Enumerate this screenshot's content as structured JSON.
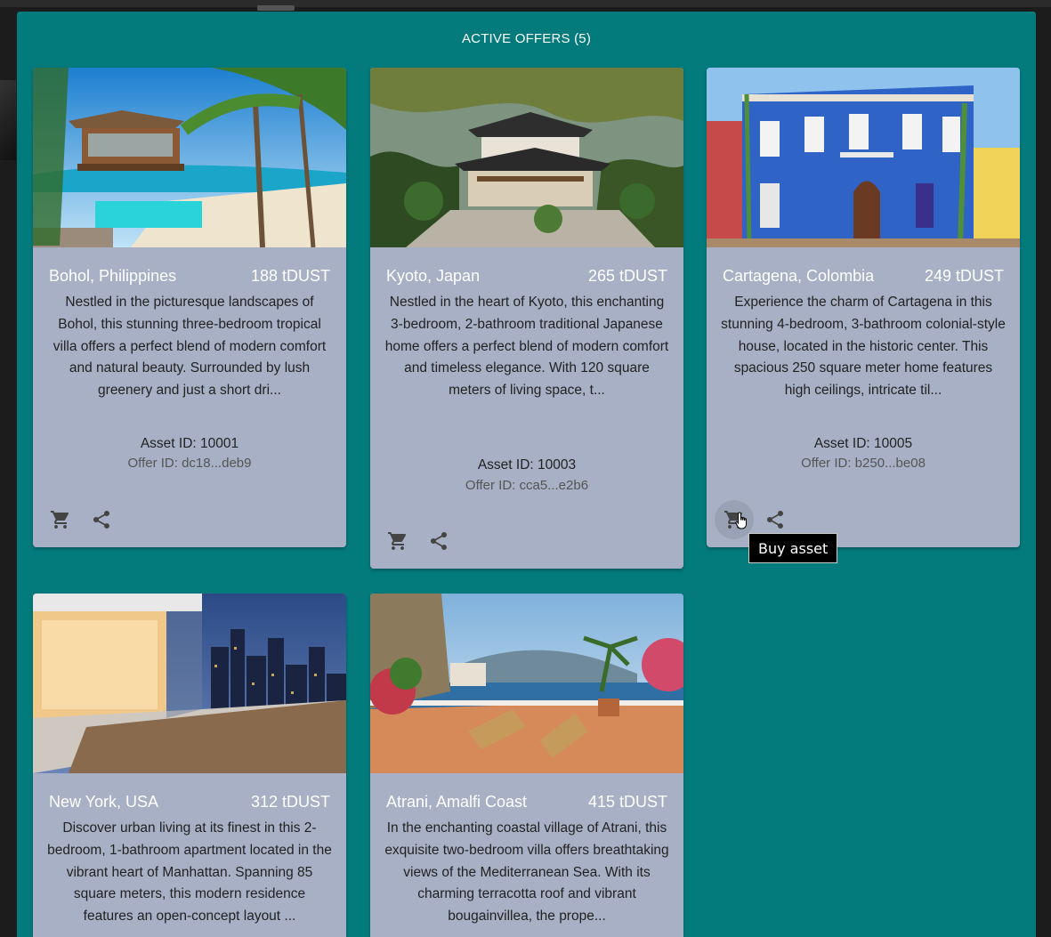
{
  "panel": {
    "title": "ACTIVE OFFERS (5)"
  },
  "offers": [
    {
      "location": "Bohol, Philippines",
      "price": "188 tDUST",
      "description": "Nestled in the picturesque landscapes of Bohol, this stunning three-bedroom tropical villa offers a perfect blend of modern comfort and natural beauty. Surrounded by lush greenery and just a short dri...",
      "asset_id": "Asset ID: 10001",
      "offer_id": "Offer ID: dc18...deb9",
      "image": "tropical-villa-pool-beach"
    },
    {
      "location": "Kyoto, Japan",
      "price": "265 tDUST",
      "description": "Nestled in the heart of Kyoto, this enchanting 3-bedroom, 2-bathroom traditional Japanese home offers a perfect blend of modern comfort and timeless elegance. With 120 square meters of living space, t...",
      "asset_id": "Asset ID: 10003",
      "offer_id": "Offer ID: cca5...e2b6",
      "image": "japanese-house-garden"
    },
    {
      "location": "Cartagena, Colombia",
      "price": "249 tDUST",
      "description": "Experience the charm of Cartagena in this stunning 4-bedroom, 3-bathroom colonial-style house, located in the historic center. This spacious 250 square meter home features high ceilings, intricate til...",
      "asset_id": "Asset ID: 10005",
      "offer_id": "Offer ID: b250...be08",
      "image": "blue-colonial-house"
    },
    {
      "location": "New York, USA",
      "price": "312 tDUST",
      "description": "Discover urban living at its finest in this 2-bedroom, 1-bathroom apartment located in the vibrant heart of Manhattan. Spanning 85 square meters, this modern residence features an open-concept layout ...",
      "image": "manhattan-penthouse-night"
    },
    {
      "location": "Atrani, Amalfi Coast",
      "price": "415 tDUST",
      "description": "In the enchanting coastal village of Atrani, this exquisite two-bedroom villa offers breathtaking views of the Mediterranean Sea. With its charming terracotta roof and vibrant bougainvillea, the prope...",
      "image": "amalfi-terrace-sea"
    }
  ],
  "icons": {
    "buy": "cart-icon",
    "share": "share-icon"
  },
  "tooltip": {
    "text": "Buy asset"
  },
  "colors": {
    "panel": "#037a7c",
    "card": "#a7b0c4"
  }
}
